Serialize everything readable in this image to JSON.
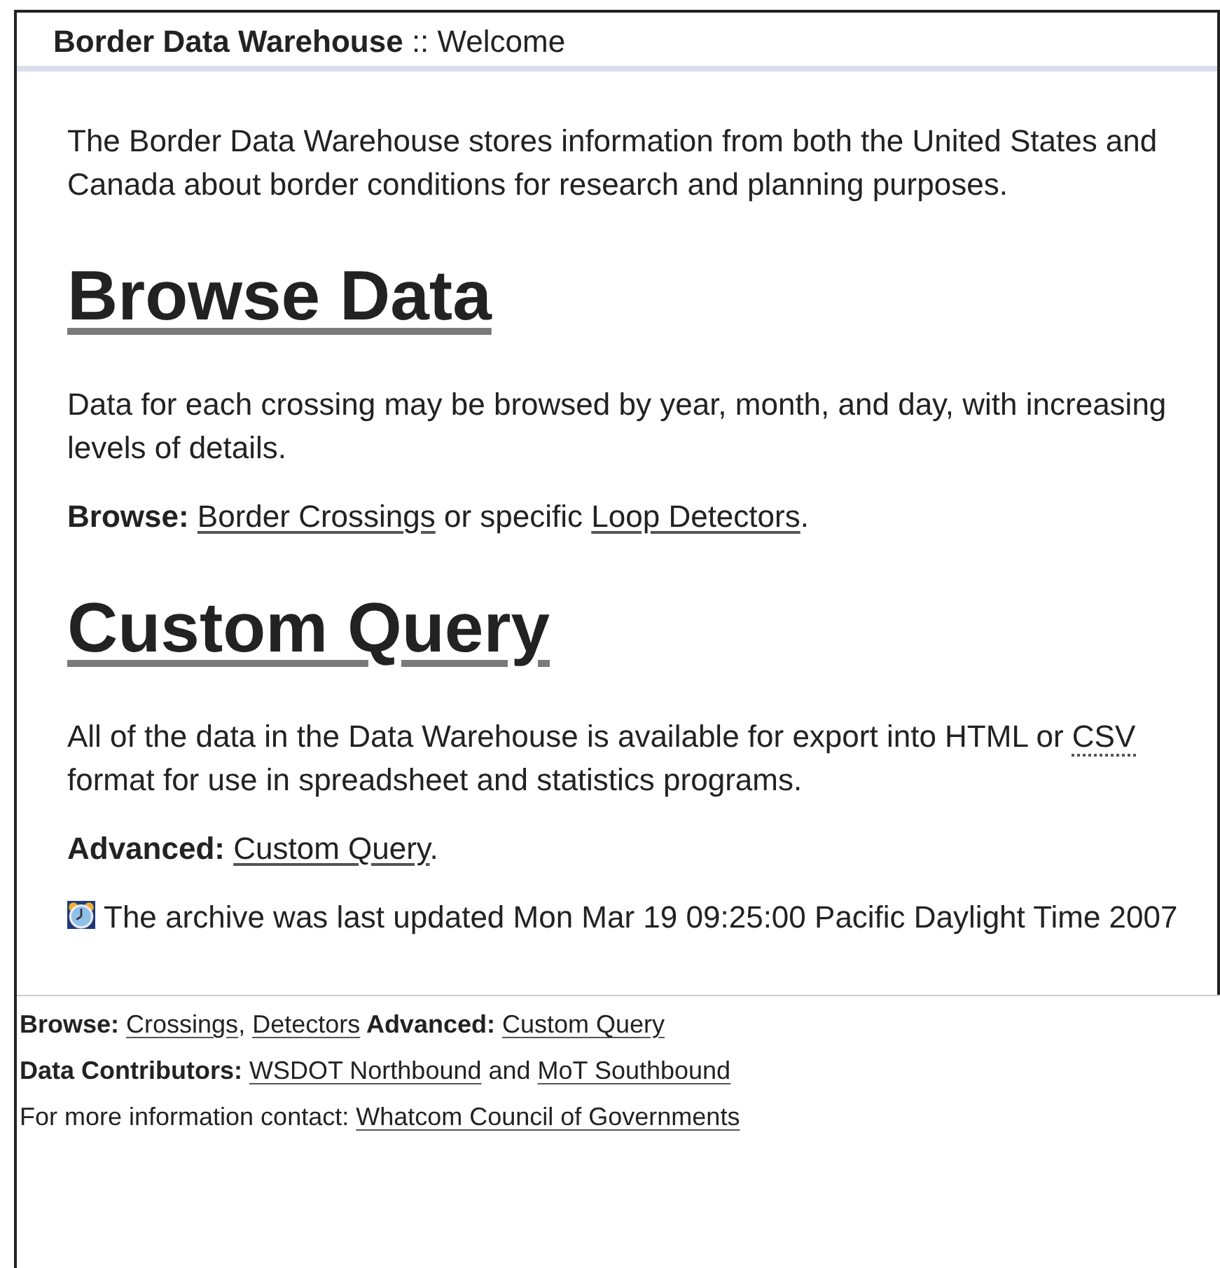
{
  "header": {
    "site": "Border Data Warehouse",
    "separator": "::",
    "page": "Welcome"
  },
  "content": [
    {
      "kind": "paragraph",
      "segments": [
        {
          "kind": "text",
          "text": "The Border Data Warehouse stores information from both the United States and Canada about border conditions for research and planning purposes."
        }
      ]
    },
    {
      "kind": "heading",
      "segments": [
        {
          "kind": "link",
          "text": "Browse Data"
        }
      ]
    },
    {
      "kind": "paragraph",
      "segments": [
        {
          "kind": "text",
          "text": "Data for each crossing may be browsed by year, month, and day, with increasing levels of details."
        }
      ]
    },
    {
      "kind": "paragraph",
      "segments": [
        {
          "kind": "bold",
          "text": "Browse: "
        },
        {
          "kind": "link",
          "text": "Border Crossings"
        },
        {
          "kind": "text",
          "text": " or specific "
        },
        {
          "kind": "link",
          "text": "Loop Detectors"
        },
        {
          "kind": "text",
          "text": "."
        }
      ]
    },
    {
      "kind": "heading",
      "segments": [
        {
          "kind": "link",
          "text": "Custom Query"
        }
      ]
    },
    {
      "kind": "paragraph",
      "segments": [
        {
          "kind": "text",
          "text": "All of the data in the Data Warehouse is available for export into HTML or "
        },
        {
          "kind": "abbr",
          "text": "CSV"
        },
        {
          "kind": "text",
          "text": " format for use in spreadsheet and statistics programs."
        }
      ]
    },
    {
      "kind": "paragraph",
      "segments": [
        {
          "kind": "bold",
          "text": "Advanced: "
        },
        {
          "kind": "link",
          "text": "Custom Query"
        },
        {
          "kind": "text",
          "text": "."
        }
      ]
    },
    {
      "kind": "notice",
      "segments": [
        {
          "kind": "text",
          "text": "The archive was last updated Mon Mar 19 09:25:00 Pacific Daylight Time 2007"
        }
      ]
    }
  ],
  "footer": [
    {
      "segments": [
        {
          "kind": "bold",
          "text": "Browse: "
        },
        {
          "kind": "link",
          "text": "Crossings"
        },
        {
          "kind": "text",
          "text": ", "
        },
        {
          "kind": "link",
          "text": "Detectors"
        },
        {
          "kind": "bold",
          "text": " Advanced: "
        },
        {
          "kind": "link",
          "text": "Custom Query"
        }
      ]
    },
    {
      "segments": [
        {
          "kind": "bold",
          "text": "Data Contributors: "
        },
        {
          "kind": "link",
          "text": "WSDOT Northbound"
        },
        {
          "kind": "text",
          "text": " and "
        },
        {
          "kind": "link",
          "text": "MoT Southbound"
        }
      ]
    },
    {
      "segments": [
        {
          "kind": "text",
          "text": "For more information contact: "
        },
        {
          "kind": "link",
          "text": "Whatcom Council of Governments"
        }
      ]
    }
  ]
}
